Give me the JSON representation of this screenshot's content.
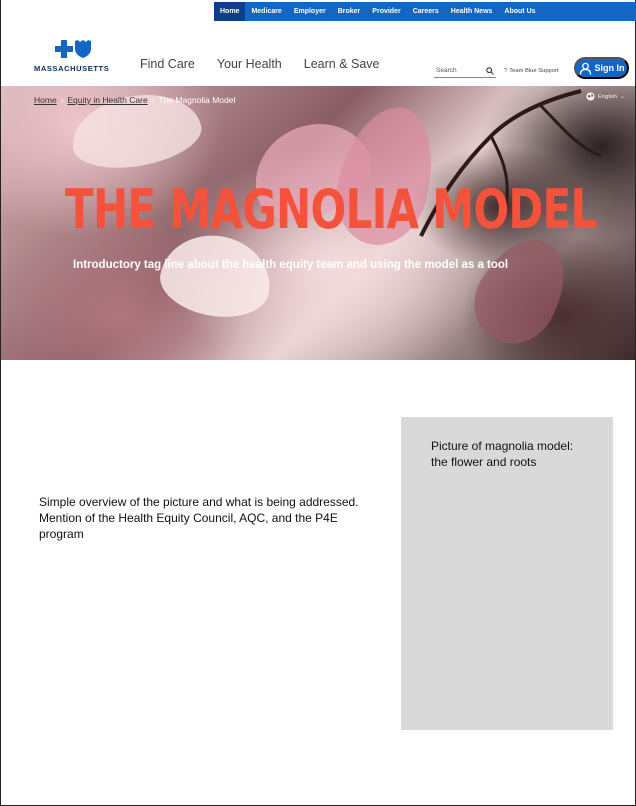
{
  "top_nav": {
    "items": [
      {
        "label": "Home",
        "active": true
      },
      {
        "label": "Medicare"
      },
      {
        "label": "Employer"
      },
      {
        "label": "Broker"
      },
      {
        "label": "Provider"
      },
      {
        "label": "Careers"
      },
      {
        "label": "Health News"
      },
      {
        "label": "About Us"
      }
    ]
  },
  "header": {
    "logo_text": "MASSACHUSETTS",
    "nav": [
      "Find Care",
      "Your Health",
      "Learn & Save"
    ],
    "search_placeholder": "Search",
    "support_label": "Team Blue Support",
    "sign_in_label": "Sign In"
  },
  "hero": {
    "breadcrumb": [
      "Home",
      "Equity in Health Care",
      "The Magnolia Model"
    ],
    "language": "English",
    "title": "THE MAGNOLIA MODEL",
    "tagline": "Introductory tag line about the health equity team and using the model as a tool"
  },
  "content": {
    "overview": "Simple overview of the picture and what is being addressed. Mention of the Health Equity Council, AQC, and the P4E program",
    "image_caption": "Picture of magnolia model: the flower and roots"
  },
  "colors": {
    "brand_blue": "#1466c4",
    "active_nav": "#0b3f86",
    "title_orange": "#f4523b",
    "placeholder_gray": "#d9d9d9"
  }
}
